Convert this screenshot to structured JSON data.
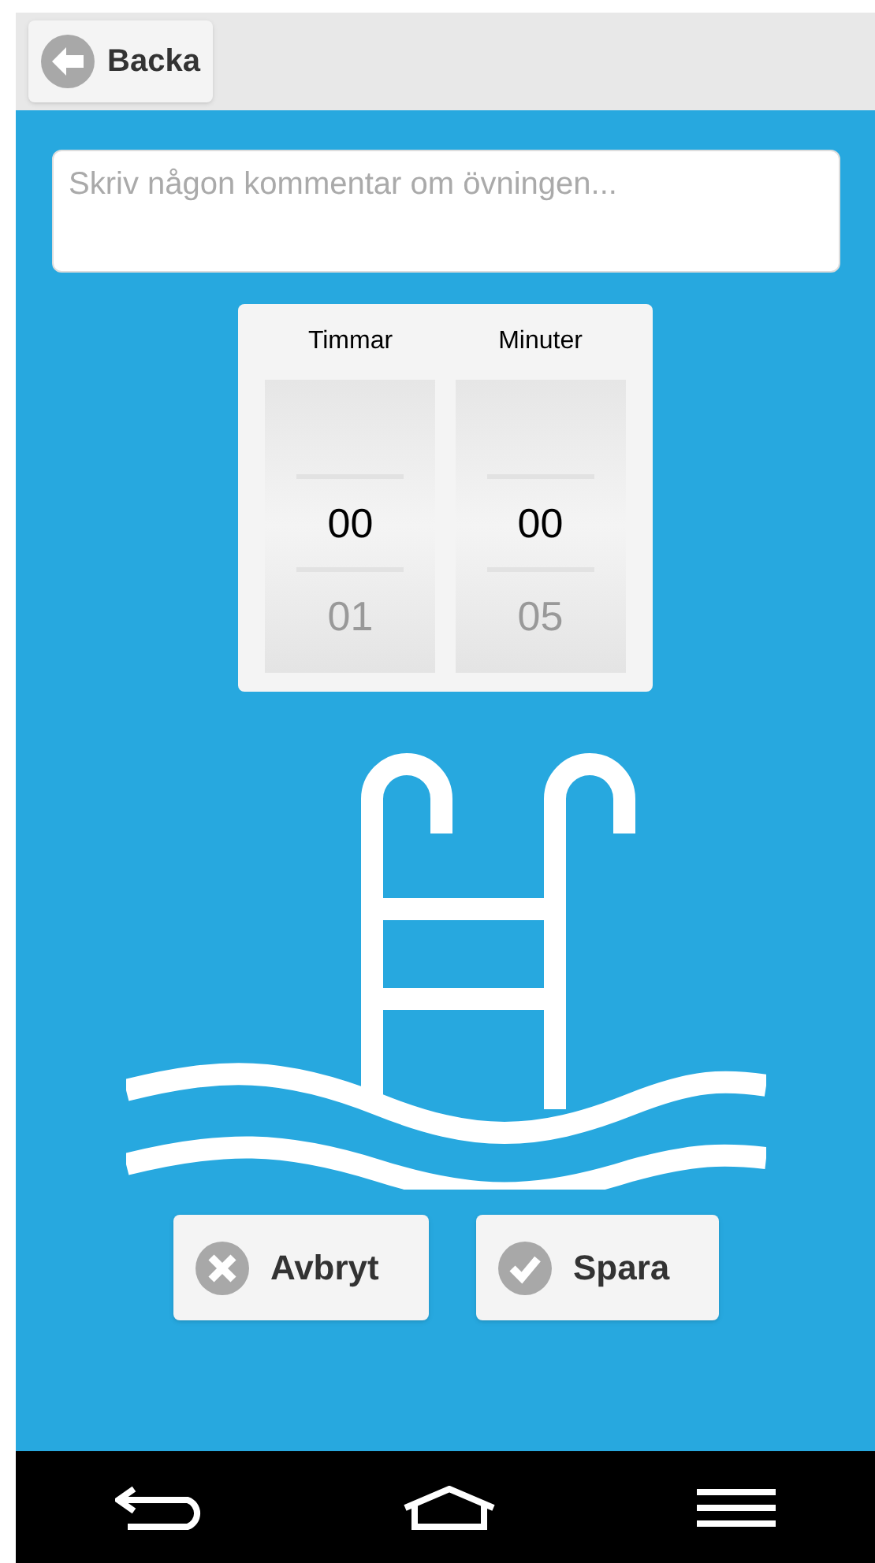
{
  "header": {
    "back_button": "Backa"
  },
  "comment": {
    "placeholder": "Skriv någon kommentar om övningen..."
  },
  "picker": [
    {
      "label": "Timmar",
      "values": [
        {
          "text": "00",
          "selected": true
        },
        {
          "text": "01",
          "selected": false
        }
      ]
    },
    {
      "label": "Minuter",
      "values": [
        {
          "text": "00",
          "selected": true
        },
        {
          "text": "05",
          "selected": false
        }
      ]
    }
  ],
  "buttons": [
    {
      "kind": "cancel",
      "label": "Avbryt"
    },
    {
      "kind": "save",
      "label": "Spara"
    }
  ]
}
